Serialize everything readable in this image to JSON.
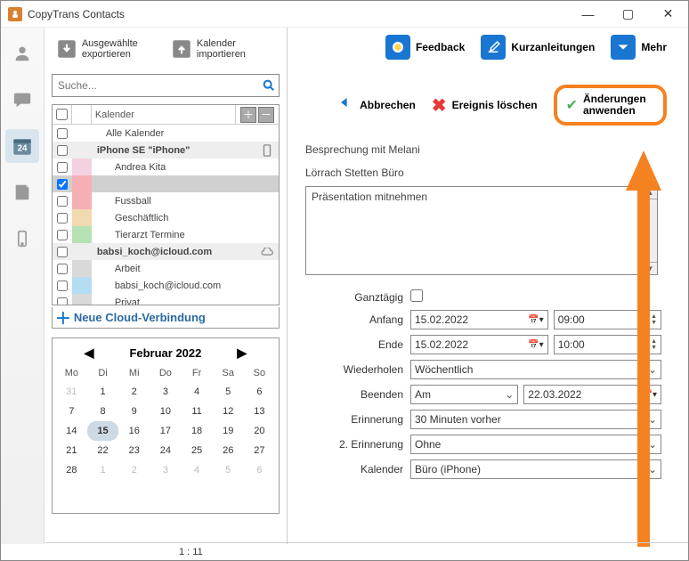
{
  "app": {
    "title": "CopyTrans Contacts"
  },
  "toolbar": {
    "export_label": "Ausgewählte exportieren",
    "import_label": "Kalender importieren",
    "feedback": "Feedback",
    "quickguides": "Kurzanleitungen",
    "more": "Mehr"
  },
  "actions": {
    "cancel": "Abbrechen",
    "delete_event": "Ereignis löschen",
    "apply": "Änderungen anwenden"
  },
  "search": {
    "placeholder": "Suche..."
  },
  "listheader": {
    "name": "Kalender"
  },
  "calendars": [
    {
      "type": "row",
      "label": "Alle Kalender",
      "indent": 1,
      "color": ""
    },
    {
      "type": "header",
      "label": "iPhone SE \"iPhone\"",
      "icon": "phone"
    },
    {
      "type": "row",
      "label": "Andrea Kita",
      "indent": 2,
      "color": "#f3d1e1"
    },
    {
      "type": "row",
      "label": "",
      "indent": 2,
      "color": "#f6b0b4",
      "selected": true,
      "checked": true
    },
    {
      "type": "row",
      "label": "Fussball",
      "indent": 2,
      "color": "#f6b0b4"
    },
    {
      "type": "row",
      "label": "Geschäftlich",
      "indent": 2,
      "color": "#f1d9b0"
    },
    {
      "type": "row",
      "label": "Tierarzt Termine",
      "indent": 2,
      "color": "#b6e2b6"
    },
    {
      "type": "header",
      "label": "babsi_koch@icloud.com",
      "icon": "cloud"
    },
    {
      "type": "row",
      "label": "Arbeit",
      "indent": 2,
      "color": "#d9d9d9"
    },
    {
      "type": "row",
      "label": "babsi_koch@icloud.com",
      "indent": 2,
      "color": "#b5ddf2"
    },
    {
      "type": "row",
      "label": "Privat",
      "indent": 2,
      "color": "#d9d9d9"
    }
  ],
  "cloud_new": "Neue Cloud-Verbindung",
  "calendar": {
    "title": "Februar 2022",
    "weekdays": [
      "Mo",
      "Di",
      "Mi",
      "Do",
      "Fr",
      "Sa",
      "So"
    ],
    "grid": [
      {
        "d": "31",
        "dim": true
      },
      {
        "d": "1"
      },
      {
        "d": "2"
      },
      {
        "d": "3"
      },
      {
        "d": "4"
      },
      {
        "d": "5"
      },
      {
        "d": "6"
      },
      {
        "d": "7"
      },
      {
        "d": "8"
      },
      {
        "d": "9"
      },
      {
        "d": "10"
      },
      {
        "d": "11"
      },
      {
        "d": "12"
      },
      {
        "d": "13"
      },
      {
        "d": "14"
      },
      {
        "d": "15",
        "sel": true
      },
      {
        "d": "16"
      },
      {
        "d": "17"
      },
      {
        "d": "18"
      },
      {
        "d": "19"
      },
      {
        "d": "20"
      },
      {
        "d": "21"
      },
      {
        "d": "22"
      },
      {
        "d": "23"
      },
      {
        "d": "24"
      },
      {
        "d": "25"
      },
      {
        "d": "26"
      },
      {
        "d": "27"
      },
      {
        "d": "28"
      },
      {
        "d": "1",
        "dim": true
      },
      {
        "d": "2",
        "dim": true
      },
      {
        "d": "3",
        "dim": true
      },
      {
        "d": "4",
        "dim": true
      },
      {
        "d": "5",
        "dim": true
      },
      {
        "d": "6",
        "dim": true
      }
    ]
  },
  "event": {
    "title": "Besprechung mit Melani",
    "location": "Lörrach Stetten Büro",
    "notes": "Präsentation mitnehmen",
    "labels": {
      "allday": "Ganztägig",
      "start": "Anfang",
      "end": "Ende",
      "repeat": "Wiederholen",
      "repeat_end": "Beenden",
      "reminder": "Erinnerung",
      "reminder2": "2. Erinnerung",
      "calendar": "Kalender"
    },
    "values": {
      "start_date": "15.02.2022",
      "start_time": "09:00",
      "end_date": "15.02.2022",
      "end_time": "10:00",
      "repeat": "Wöchentlich",
      "repeat_end_mode": "Am",
      "repeat_end_date": "22.03.2022",
      "reminder": "30 Minuten vorher",
      "reminder2": "Ohne",
      "calendar": "Büro (iPhone)"
    }
  },
  "status": {
    "count": "1 : 11"
  }
}
